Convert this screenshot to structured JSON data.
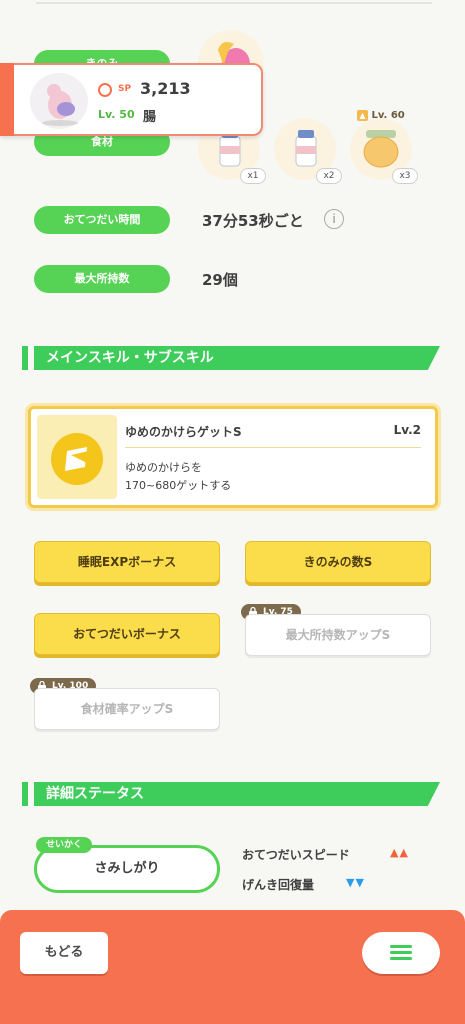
{
  "pokemon": {
    "sp_label": "SP",
    "sp_value": "3,213",
    "level": "Lv. 50",
    "specialty": "腸"
  },
  "berry": {
    "label": "きのみ"
  },
  "ingredients": {
    "label": "食材",
    "items": [
      {
        "icon": "milk-bottle-icon",
        "qty": "x1"
      },
      {
        "icon": "milk-bottle-icon",
        "qty": "x2"
      },
      {
        "icon": "honey-jar-icon",
        "qty": "x3",
        "unlock": "Lv. 60"
      }
    ]
  },
  "help_interval": {
    "label": "おてつだい時間",
    "value": "37分53秒ごと"
  },
  "max_carry": {
    "label": "最大所持数",
    "value": "29個"
  },
  "skills_section": {
    "title": "メインスキル・サブスキル"
  },
  "main_skill": {
    "name": "ゆめのかけらゲットS",
    "level": "Lv.2",
    "description": "ゆめのかけらを\n170~680ゲットする"
  },
  "sub_skills": [
    {
      "label": "睡眠EXPボーナス",
      "unlocked": true
    },
    {
      "label": "きのみの数S",
      "unlocked": true
    },
    {
      "label": "おてつだいボーナス",
      "unlocked": true
    },
    {
      "label": "最大所持数アップS",
      "unlocked": false,
      "unlock": "Lv. 75"
    },
    {
      "label": "食材確率アップS",
      "unlocked": false,
      "unlock": "Lv. 100"
    }
  ],
  "detail_section": {
    "title": "詳細ステータス"
  },
  "nature": {
    "tag": "せいかく",
    "value": "さみしがり",
    "up_label": "おてつだいスピード",
    "up_arrows": "▲▲",
    "down_label": "げんき回復量",
    "down_arrows": "▼▼"
  },
  "footer": {
    "back_label": "もどる"
  },
  "colors": {
    "green": "#56d255",
    "orange": "#f5714f",
    "yellow": "#fbdc4b",
    "up_red": "#f0623a",
    "down_blue": "#2a9de8"
  }
}
